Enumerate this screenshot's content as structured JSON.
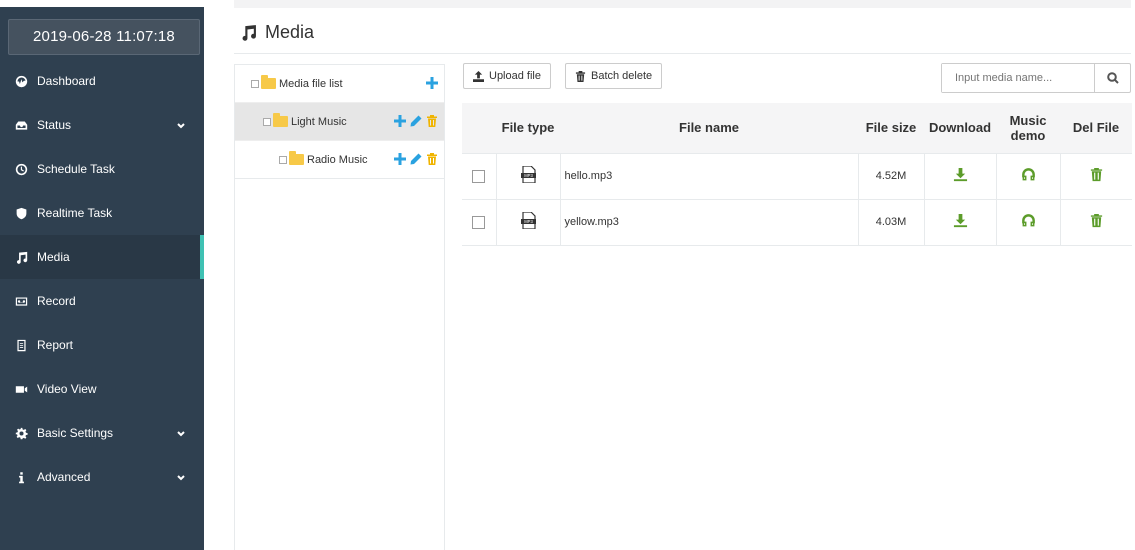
{
  "clock": "2019-06-28 11:07:18",
  "nav": [
    {
      "label": "Dashboard",
      "icon": "dashboard-icon",
      "expandable": false
    },
    {
      "label": "Status",
      "icon": "status-icon",
      "expandable": true
    },
    {
      "label": "Schedule Task",
      "icon": "clock-icon",
      "expandable": false
    },
    {
      "label": "Realtime Task",
      "icon": "shield-icon",
      "expandable": false
    },
    {
      "label": "Media",
      "icon": "music-icon",
      "expandable": false,
      "active": true
    },
    {
      "label": "Record",
      "icon": "cassette-icon",
      "expandable": false
    },
    {
      "label": "Report",
      "icon": "report-icon",
      "expandable": false
    },
    {
      "label": "Video View",
      "icon": "video-camera-icon",
      "expandable": true
    },
    {
      "label": "Basic Settings",
      "icon": "gear-icon",
      "expandable": true
    },
    {
      "label": "Advanced",
      "icon": "info-icon",
      "expandable": true
    }
  ],
  "page": {
    "title": "Media"
  },
  "tree": {
    "root": "Media file list",
    "children": [
      {
        "label": "Light Music",
        "selected": true
      },
      {
        "label": "Radio Music",
        "selected": false
      }
    ]
  },
  "toolbar": {
    "upload_label": "Upload file",
    "batch_delete_label": "Batch delete",
    "search_placeholder": "Input media name..."
  },
  "table": {
    "headers": [
      "File type",
      "File name",
      "File size",
      "Download",
      "Music demo",
      "Del File"
    ],
    "rows": [
      {
        "type": "MP3",
        "name": "hello.mp3",
        "size": "4.52M"
      },
      {
        "type": "MP3",
        "name": "yellow.mp3",
        "size": "4.03M"
      }
    ]
  },
  "colors": {
    "sidebar_bg": "#2f4050",
    "active_accent": "#3fc1b3",
    "action_green": "#5c9c2a",
    "tree_add_blue": "#2aa2e0",
    "tree_delete_yellow": "#f0b400"
  }
}
